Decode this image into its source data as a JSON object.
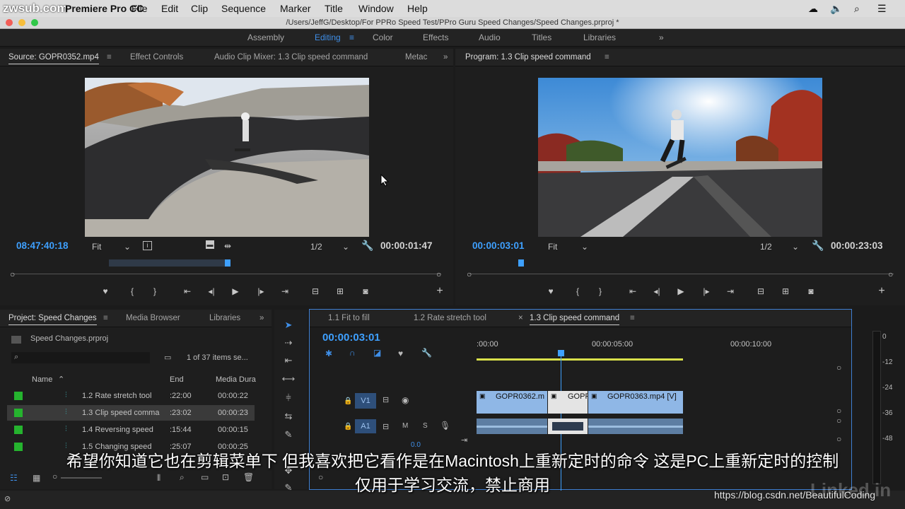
{
  "watermark_top": "zwsub.com",
  "menubar": {
    "app": "Premiere Pro CC",
    "items": [
      "File",
      "Edit",
      "Clip",
      "Sequence",
      "Marker",
      "Title",
      "Window",
      "Help"
    ]
  },
  "window_title": "/Users/JeffG/Desktop/For PPRo Speed Test/PPro Guru Speed Changes/Speed Changes.prproj *",
  "workspaces": [
    "Assembly",
    "Editing",
    "Color",
    "Effects",
    "Audio",
    "Titles",
    "Libraries"
  ],
  "source": {
    "tabs": [
      "Source: GOPR0352.mp4",
      "Effect Controls",
      "Audio Clip Mixer: 1.3 Clip speed command",
      "Metac"
    ],
    "timecode": "08:47:40:18",
    "fit": "Fit",
    "resolution": "1/2",
    "duration": "00:00:01:47"
  },
  "program": {
    "tab": "Program: 1.3 Clip speed command",
    "timecode": "00:00:03:01",
    "fit": "Fit",
    "resolution": "1/2",
    "duration": "00:00:23:03"
  },
  "project": {
    "tabs": [
      "Project: Speed Changes",
      "Media Browser",
      "Libraries"
    ],
    "file": "Speed Changes.prproj",
    "count": "1 of 37 items se...",
    "columns": [
      "Name",
      "End",
      "Media Dura"
    ],
    "rows": [
      {
        "name": "1.2 Rate stretch tool",
        "end": ":22:00",
        "dur": "00:00:22"
      },
      {
        "name": "1.3 Clip speed comma",
        "end": ":23:02",
        "dur": "00:00:23"
      },
      {
        "name": "1.4 Reversing speed",
        "end": ":15:44",
        "dur": "00:00:15"
      },
      {
        "name": "1.5 Changing speed",
        "end": ":25:07",
        "dur": "00:00:25"
      }
    ]
  },
  "timeline": {
    "tabs": [
      "1.1 Fit to fill",
      "1.2 Rate stretch tool",
      "1.3 Clip speed command"
    ],
    "timecode": "00:00:03:01",
    "ruler": [
      ":00:00",
      "00:00:05:00",
      "00:00:10:00"
    ],
    "tracks": {
      "v1": "V1",
      "a1": "A1",
      "m": "M",
      "s": "S"
    },
    "clips": [
      "GOPR0362.m",
      "GOPR",
      "GOPR0363.mp4 [V]"
    ],
    "audio_value": "0.0",
    "meter": [
      "0",
      "-12",
      "-24",
      "-36",
      "-48"
    ]
  },
  "subtitles": {
    "line1": "希望你知道它也在剪辑菜单下  但我喜欢把它看作是在Macintosh上重新定时的命令  这是PC上重新定时的控制",
    "line2": "仅用于学习交流，禁止商用"
  },
  "footer": {
    "url": "https://blog.csdn.net/BeautifulCoding",
    "brand": "Linked in"
  },
  "colors": {
    "accent": "#3f8fe8",
    "timecode": "#3ea0ff",
    "label_green": "#25b32e",
    "clip_video": "#8fb7e6",
    "clip_audio": "#5d7ea3"
  }
}
